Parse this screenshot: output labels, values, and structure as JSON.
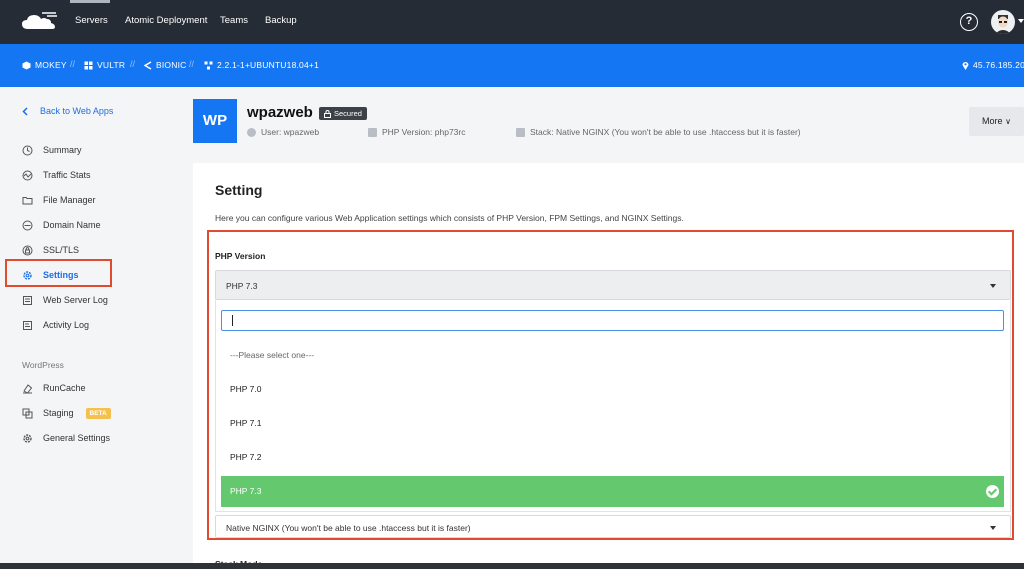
{
  "topbar": {
    "nav": [
      "Servers",
      "Atomic Deployment",
      "Teams",
      "Backup"
    ],
    "icons": {
      "logo": "cloud-logo-icon",
      "help": "help-icon",
      "avatar": "user-avatar"
    }
  },
  "infobar": {
    "server": "MOKEY",
    "provider": "VULTR",
    "os": "BIONIC",
    "version": "2.2.1-1+UBUNTU18.04+1",
    "ip": "45.76.185.20",
    "separator": "//"
  },
  "sidebar": {
    "back": "Back to Web Apps",
    "items": [
      {
        "label": "Summary",
        "icon": "summary-icon"
      },
      {
        "label": "Traffic Stats",
        "icon": "traffic-icon"
      },
      {
        "label": "File Manager",
        "icon": "folder-icon"
      },
      {
        "label": "Domain Name",
        "icon": "domain-icon"
      },
      {
        "label": "SSL/TLS",
        "icon": "lock-icon"
      },
      {
        "label": "Settings",
        "icon": "gear-icon",
        "active": true
      },
      {
        "label": "Web Server Log",
        "icon": "log-icon"
      },
      {
        "label": "Activity Log",
        "icon": "activity-icon"
      }
    ],
    "section_heading": "WordPress",
    "wp_items": [
      {
        "label": "RunCache",
        "icon": "cache-icon"
      },
      {
        "label": "Staging",
        "icon": "staging-icon",
        "badge": "BETA"
      },
      {
        "label": "General Settings",
        "icon": "gear-icon"
      }
    ]
  },
  "app": {
    "initials": "WP",
    "name": "wpazweb",
    "secured": "Secured",
    "user": "User: wpazweb",
    "php": "PHP Version: php73rc",
    "stack": "Stack: Native NGINX (You won't be able to use .htaccess but it is faster)",
    "more": "More"
  },
  "main": {
    "title": "Setting",
    "description": "Here you can configure various Web Application settings which consists of PHP Version, FPM Settings, and NGINX Settings.",
    "php_label": "PHP Version",
    "php_selected": "PHP 7.3",
    "options": [
      "---Please select one---",
      "PHP 7.0",
      "PHP 7.1",
      "PHP 7.2",
      "PHP 7.3"
    ],
    "stack_value": "Native NGINX (You won't be able to use .htaccess but it is faster)",
    "stack_mode_label": "Stack Mode"
  },
  "colors": {
    "topbar": "#262c35",
    "infobar": "#1476f2",
    "accent": "#1d6ee6",
    "highlight": "#e04a2f",
    "selected": "#64c86e",
    "beta": "#f6c04d"
  }
}
